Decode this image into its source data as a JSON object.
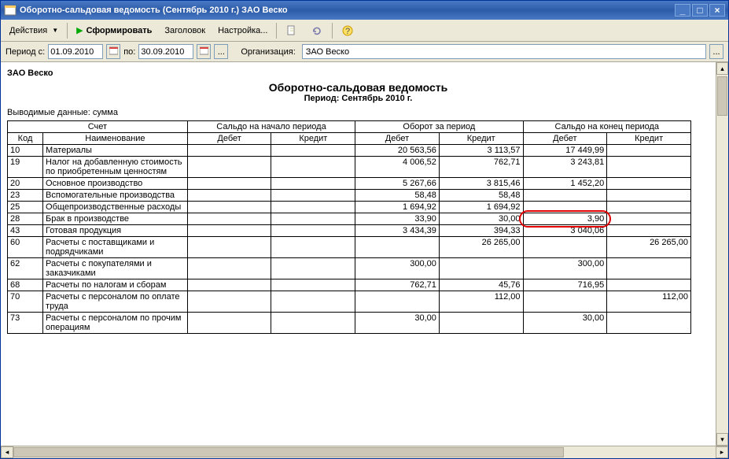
{
  "window": {
    "title": "Оборотно-сальдовая ведомость (Сентябрь 2010 г.) ЗАО Веско"
  },
  "toolbar": {
    "actions": "Действия",
    "form": "Сформировать",
    "header": "Заголовок",
    "settings": "Настройка..."
  },
  "params": {
    "period_from_label": "Период с:",
    "date_from": "01.09.2010",
    "period_to_label": "по:",
    "date_to": "30.09.2010",
    "ellipsis": "...",
    "org_label": "Организация:",
    "org_value": "ЗАО Веско"
  },
  "report": {
    "org": "ЗАО Веско",
    "title": "Оборотно-сальдовая ведомость",
    "period": "Период: Сентябрь 2010 г.",
    "subtitle": "Выводимые данные: сумма",
    "headers": {
      "account": "Счет",
      "saldo_begin": "Сальдо на начало периода",
      "turnover": "Оборот за период",
      "saldo_end": "Сальдо на конец периода",
      "code": "Код",
      "name": "Наименование",
      "debit": "Дебет",
      "credit": "Кредит"
    },
    "rows": [
      {
        "code": "10",
        "name": "Материалы",
        "sbD": "",
        "sbK": "",
        "tD": "20 563,56",
        "tK": "3 113,57",
        "seD": "17 449,99",
        "seK": ""
      },
      {
        "code": "19",
        "name": "Налог на добавленную стоимость по приобретенным ценностям",
        "sbD": "",
        "sbK": "",
        "tD": "4 006,52",
        "tK": "762,71",
        "seD": "3 243,81",
        "seK": ""
      },
      {
        "code": "20",
        "name": "Основное производство",
        "sbD": "",
        "sbK": "",
        "tD": "5 267,66",
        "tK": "3 815,46",
        "seD": "1 452,20",
        "seK": ""
      },
      {
        "code": "23",
        "name": "Вспомогательные производства",
        "sbD": "",
        "sbK": "",
        "tD": "58,48",
        "tK": "58,48",
        "seD": "",
        "seK": ""
      },
      {
        "code": "25",
        "name": "Общепроизводственные расходы",
        "sbD": "",
        "sbK": "",
        "tD": "1 694,92",
        "tK": "1 694,92",
        "seD": "",
        "seK": ""
      },
      {
        "code": "28",
        "name": "Брак в производстве",
        "sbD": "",
        "sbK": "",
        "tD": "33,90",
        "tK": "30,00",
        "seD": "3,90",
        "seK": "",
        "hl": true
      },
      {
        "code": "43",
        "name": "Готовая продукция",
        "sbD": "",
        "sbK": "",
        "tD": "3 434,39",
        "tK": "394,33",
        "seD": "3 040,06",
        "seK": ""
      },
      {
        "code": "60",
        "name": "Расчеты с поставщиками и подрядчиками",
        "sbD": "",
        "sbK": "",
        "tD": "",
        "tK": "26 265,00",
        "seD": "",
        "seK": "26 265,00"
      },
      {
        "code": "62",
        "name": "Расчеты с покупателями и заказчиками",
        "sbD": "",
        "sbK": "",
        "tD": "300,00",
        "tK": "",
        "seD": "300,00",
        "seK": ""
      },
      {
        "code": "68",
        "name": "Расчеты по налогам и сборам",
        "sbD": "",
        "sbK": "",
        "tD": "762,71",
        "tK": "45,76",
        "seD": "716,95",
        "seK": ""
      },
      {
        "code": "70",
        "name": "Расчеты с персоналом по оплате труда",
        "sbD": "",
        "sbK": "",
        "tD": "",
        "tK": "112,00",
        "seD": "",
        "seK": "112,00"
      },
      {
        "code": "73",
        "name": "Расчеты с персоналом по прочим операциям",
        "sbD": "",
        "sbK": "",
        "tD": "30,00",
        "tK": "",
        "seD": "30,00",
        "seK": ""
      }
    ]
  }
}
